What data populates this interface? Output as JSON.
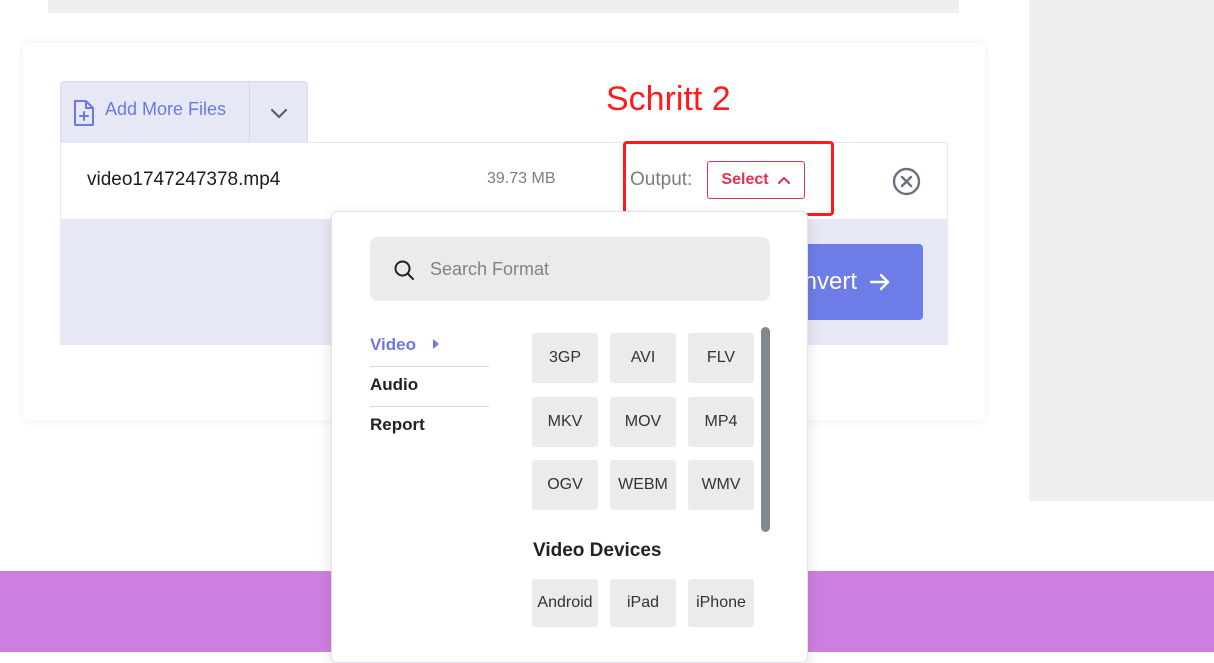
{
  "annotation": "Schritt 2",
  "uploader": {
    "add_files_label": "Add More Files"
  },
  "file": {
    "name": "video1747247378.mp4",
    "size": "39.73 MB",
    "output_label": "Output:",
    "select_label": "Select"
  },
  "convert": {
    "label": "Convert"
  },
  "dropdown": {
    "search_placeholder": "Search Format",
    "categories": [
      "Video",
      "Audio",
      "Report"
    ],
    "active_category": "Video",
    "formats": [
      "3GP",
      "AVI",
      "FLV",
      "MKV",
      "MOV",
      "MP4",
      "OGV",
      "WEBM",
      "WMV"
    ],
    "devices_heading": "Video Devices",
    "devices": [
      "Android",
      "iPad",
      "iPhone"
    ]
  },
  "colors": {
    "accent": "#6b78e6",
    "danger": "#e3314f",
    "annotation": "#ff1b1b",
    "footer": "#cc7fdf"
  }
}
